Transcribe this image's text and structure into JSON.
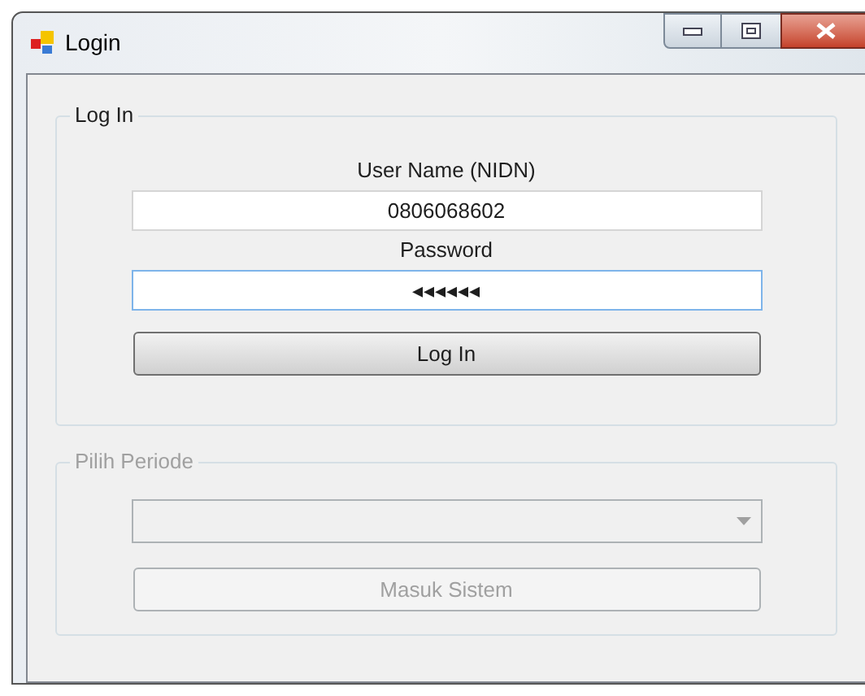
{
  "window": {
    "title": "Login"
  },
  "login_group": {
    "title": "Log In",
    "disabled": false,
    "username": {
      "label": "User Name (NIDN)",
      "value": "0806068602",
      "focused": false
    },
    "password": {
      "label": "Password",
      "value": "◂◂◂◂◂◂",
      "focused": true
    },
    "button": "Log In"
  },
  "period_group": {
    "title": "Pilih Periode",
    "disabled": true,
    "button": "Masuk Sistem"
  }
}
